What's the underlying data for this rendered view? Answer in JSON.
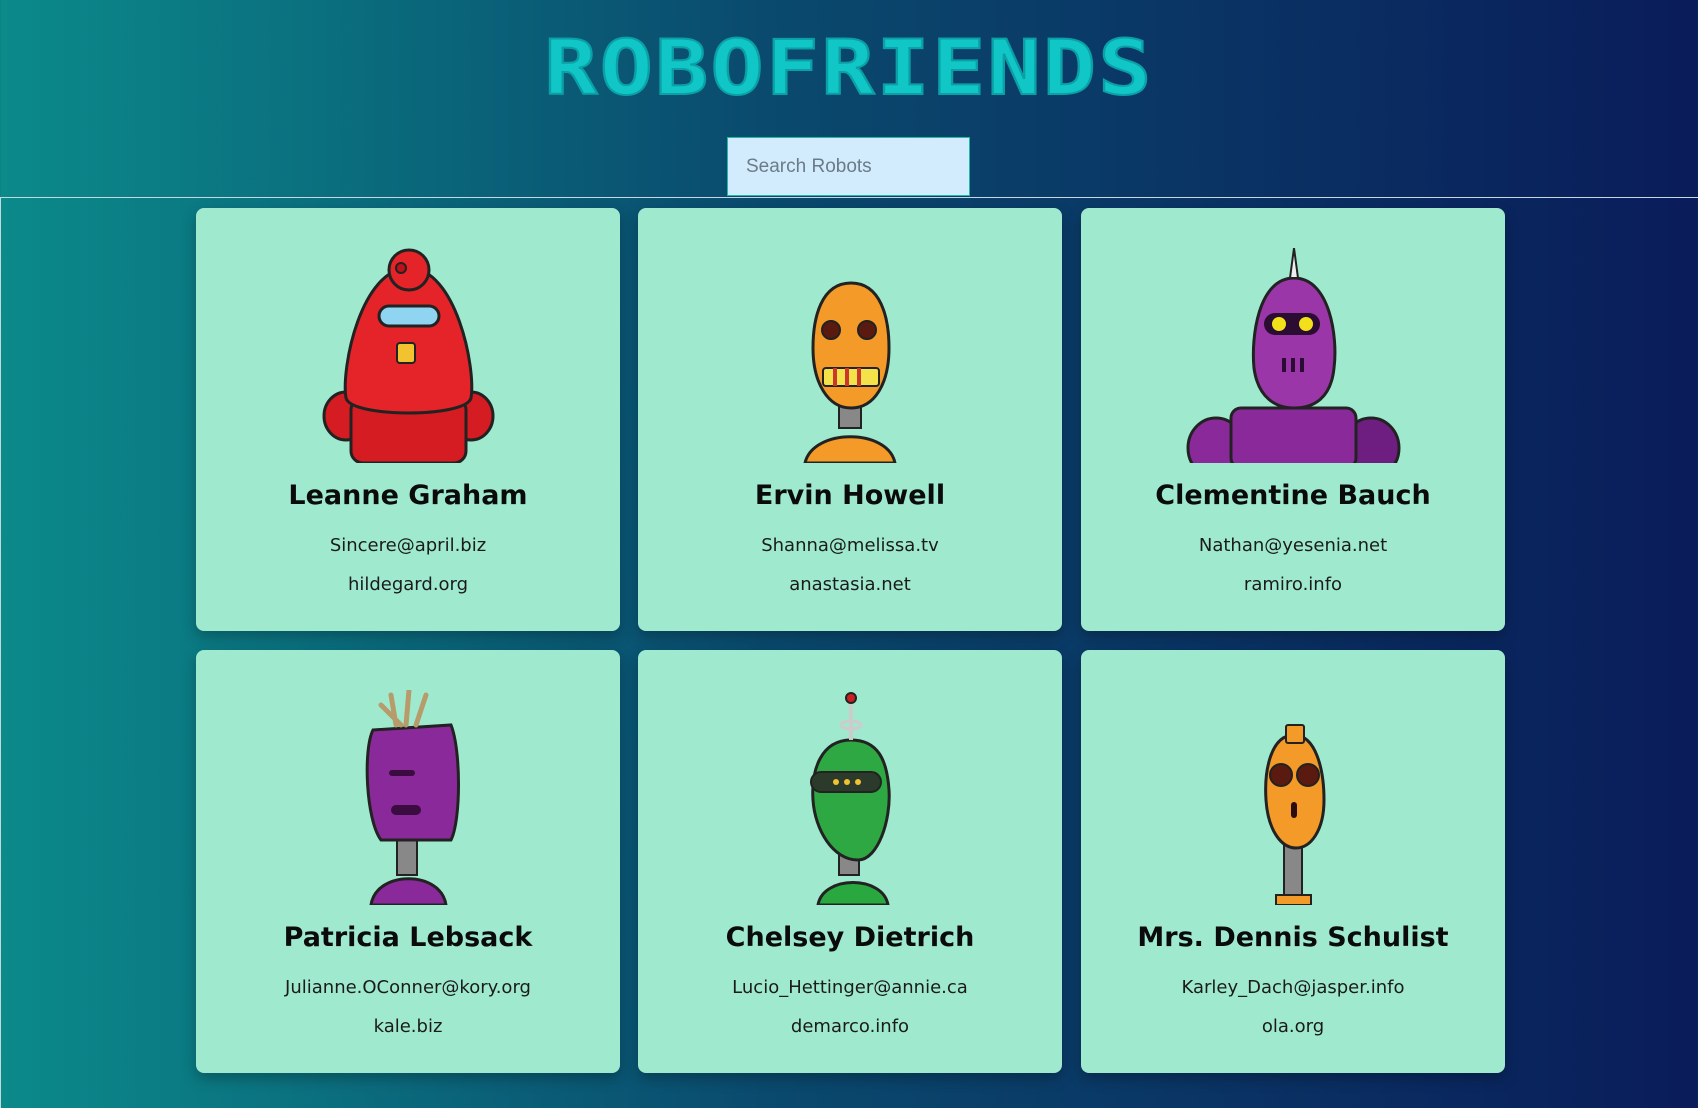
{
  "app": {
    "title": "ROBOFRIENDS"
  },
  "search": {
    "placeholder": "Search Robots",
    "value": ""
  },
  "colors": {
    "card_background": "#9feacf",
    "search_background": "#d2ecfd",
    "logo": "#10c6c6"
  },
  "robots": [
    {
      "name": "Leanne Graham",
      "email": "Sincere@april.biz",
      "website": "hildegard.org",
      "avatar": "red-robot"
    },
    {
      "name": "Ervin Howell",
      "email": "Shanna@melissa.tv",
      "website": "anastasia.net",
      "avatar": "orange-robot"
    },
    {
      "name": "Clementine Bauch",
      "email": "Nathan@yesenia.net",
      "website": "ramiro.info",
      "avatar": "purple-robot"
    },
    {
      "name": "Patricia Lebsack",
      "email": "Julianne.OConner@kory.org",
      "website": "kale.biz",
      "avatar": "purple-robot"
    },
    {
      "name": "Chelsey Dietrich",
      "email": "Lucio_Hettinger@annie.ca",
      "website": "demarco.info",
      "avatar": "green-robot"
    },
    {
      "name": "Mrs. Dennis Schulist",
      "email": "Karley_Dach@jasper.info",
      "website": "ola.org",
      "avatar": "orange-robot"
    }
  ]
}
